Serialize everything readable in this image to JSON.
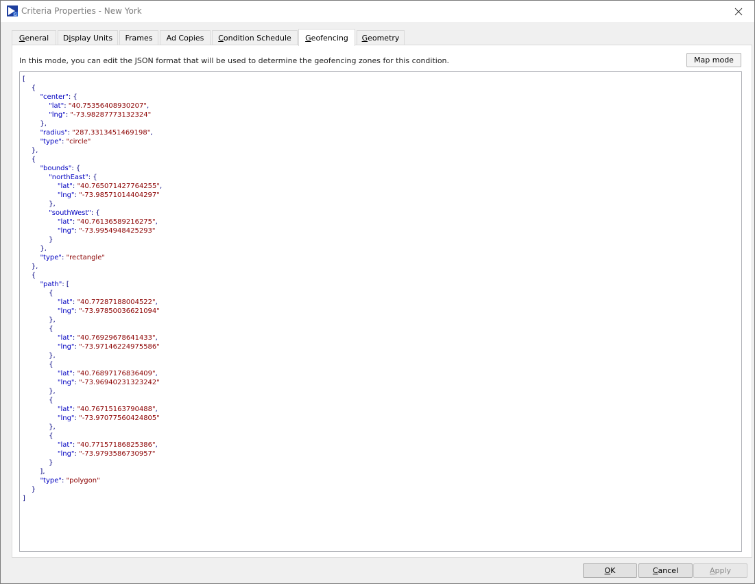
{
  "window": {
    "title": "Criteria Properties - New York"
  },
  "tabs": [
    {
      "label": "General",
      "mnemonic_index": 0
    },
    {
      "label": "Display Units",
      "mnemonic_index": 1
    },
    {
      "label": "Frames",
      "mnemonic_index": -1
    },
    {
      "label": "Ad Copies",
      "mnemonic_index": -1
    },
    {
      "label": "Condition Schedule",
      "mnemonic_index": 0
    },
    {
      "label": "Geofencing",
      "mnemonic_index": 0,
      "active": true
    },
    {
      "label": "Geometry",
      "mnemonic_index": 0
    }
  ],
  "geofencing": {
    "description": "In this mode, you can edit the JSON format that will be used to determine the geofencing zones for this condition.",
    "map_mode_label": "Map mode",
    "json_lines": [
      [
        [
          "p",
          "["
        ]
      ],
      [
        [
          "p",
          "    {"
        ]
      ],
      [
        [
          "p",
          "        "
        ],
        [
          "k",
          "\"center\""
        ],
        [
          "p",
          ": {"
        ]
      ],
      [
        [
          "p",
          "            "
        ],
        [
          "k",
          "\"lat\""
        ],
        [
          "p",
          ": "
        ],
        [
          "s",
          "\"40.75356408930207\""
        ],
        [
          "p",
          ","
        ]
      ],
      [
        [
          "p",
          "            "
        ],
        [
          "k",
          "\"lng\""
        ],
        [
          "p",
          ": "
        ],
        [
          "s",
          "\"-73.98287773132324\""
        ]
      ],
      [
        [
          "p",
          "        },"
        ]
      ],
      [
        [
          "p",
          "        "
        ],
        [
          "k",
          "\"radius\""
        ],
        [
          "p",
          ": "
        ],
        [
          "s",
          "\"287.3313451469198\""
        ],
        [
          "p",
          ","
        ]
      ],
      [
        [
          "p",
          "        "
        ],
        [
          "k",
          "\"type\""
        ],
        [
          "p",
          ": "
        ],
        [
          "s",
          "\"circle\""
        ]
      ],
      [
        [
          "p",
          "    },"
        ]
      ],
      [
        [
          "p",
          "    {"
        ]
      ],
      [
        [
          "p",
          "        "
        ],
        [
          "k",
          "\"bounds\""
        ],
        [
          "p",
          ": {"
        ]
      ],
      [
        [
          "p",
          "            "
        ],
        [
          "k",
          "\"northEast\""
        ],
        [
          "p",
          ": {"
        ]
      ],
      [
        [
          "p",
          "                "
        ],
        [
          "k",
          "\"lat\""
        ],
        [
          "p",
          ": "
        ],
        [
          "s",
          "\"40.765071427764255\""
        ],
        [
          "p",
          ","
        ]
      ],
      [
        [
          "p",
          "                "
        ],
        [
          "k",
          "\"lng\""
        ],
        [
          "p",
          ": "
        ],
        [
          "s",
          "\"-73.98571014404297\""
        ]
      ],
      [
        [
          "p",
          "            },"
        ]
      ],
      [
        [
          "p",
          "            "
        ],
        [
          "k",
          "\"southWest\""
        ],
        [
          "p",
          ": {"
        ]
      ],
      [
        [
          "p",
          "                "
        ],
        [
          "k",
          "\"lat\""
        ],
        [
          "p",
          ": "
        ],
        [
          "s",
          "\"40.76136589216275\""
        ],
        [
          "p",
          ","
        ]
      ],
      [
        [
          "p",
          "                "
        ],
        [
          "k",
          "\"lng\""
        ],
        [
          "p",
          ": "
        ],
        [
          "s",
          "\"-73.9954948425293\""
        ]
      ],
      [
        [
          "p",
          "            }"
        ]
      ],
      [
        [
          "p",
          "        },"
        ]
      ],
      [
        [
          "p",
          "        "
        ],
        [
          "k",
          "\"type\""
        ],
        [
          "p",
          ": "
        ],
        [
          "s",
          "\"rectangle\""
        ]
      ],
      [
        [
          "p",
          "    },"
        ]
      ],
      [
        [
          "p",
          "    {"
        ]
      ],
      [
        [
          "p",
          "        "
        ],
        [
          "k",
          "\"path\""
        ],
        [
          "p",
          ": ["
        ]
      ],
      [
        [
          "p",
          "            {"
        ]
      ],
      [
        [
          "p",
          "                "
        ],
        [
          "k",
          "\"lat\""
        ],
        [
          "p",
          ": "
        ],
        [
          "s",
          "\"40.77287188004522\""
        ],
        [
          "p",
          ","
        ]
      ],
      [
        [
          "p",
          "                "
        ],
        [
          "k",
          "\"lng\""
        ],
        [
          "p",
          ": "
        ],
        [
          "s",
          "\"-73.97850036621094\""
        ]
      ],
      [
        [
          "p",
          "            },"
        ]
      ],
      [
        [
          "p",
          "            {"
        ]
      ],
      [
        [
          "p",
          "                "
        ],
        [
          "k",
          "\"lat\""
        ],
        [
          "p",
          ": "
        ],
        [
          "s",
          "\"40.76929678641433\""
        ],
        [
          "p",
          ","
        ]
      ],
      [
        [
          "p",
          "                "
        ],
        [
          "k",
          "\"lng\""
        ],
        [
          "p",
          ": "
        ],
        [
          "s",
          "\"-73.97146224975586\""
        ]
      ],
      [
        [
          "p",
          "            },"
        ]
      ],
      [
        [
          "p",
          "            {"
        ]
      ],
      [
        [
          "p",
          "                "
        ],
        [
          "k",
          "\"lat\""
        ],
        [
          "p",
          ": "
        ],
        [
          "s",
          "\"40.76897176836409\""
        ],
        [
          "p",
          ","
        ]
      ],
      [
        [
          "p",
          "                "
        ],
        [
          "k",
          "\"lng\""
        ],
        [
          "p",
          ": "
        ],
        [
          "s",
          "\"-73.96940231323242\""
        ]
      ],
      [
        [
          "p",
          "            },"
        ]
      ],
      [
        [
          "p",
          "            {"
        ]
      ],
      [
        [
          "p",
          "                "
        ],
        [
          "k",
          "\"lat\""
        ],
        [
          "p",
          ": "
        ],
        [
          "s",
          "\"40.76715163790488\""
        ],
        [
          "p",
          ","
        ]
      ],
      [
        [
          "p",
          "                "
        ],
        [
          "k",
          "\"lng\""
        ],
        [
          "p",
          ": "
        ],
        [
          "s",
          "\"-73.97077560424805\""
        ]
      ],
      [
        [
          "p",
          "            },"
        ]
      ],
      [
        [
          "p",
          "            {"
        ]
      ],
      [
        [
          "p",
          "                "
        ],
        [
          "k",
          "\"lat\""
        ],
        [
          "p",
          ": "
        ],
        [
          "s",
          "\"40.77157186825386\""
        ],
        [
          "p",
          ","
        ]
      ],
      [
        [
          "p",
          "                "
        ],
        [
          "k",
          "\"lng\""
        ],
        [
          "p",
          ": "
        ],
        [
          "s",
          "\"-73.9793586730957\""
        ]
      ],
      [
        [
          "p",
          "            }"
        ]
      ],
      [
        [
          "p",
          "        ],"
        ]
      ],
      [
        [
          "p",
          "        "
        ],
        [
          "k",
          "\"type\""
        ],
        [
          "p",
          ": "
        ],
        [
          "s",
          "\"polygon\""
        ]
      ],
      [
        [
          "p",
          "    }"
        ]
      ],
      [
        [
          "p",
          "]"
        ]
      ]
    ]
  },
  "footer": {
    "ok_label": "OK",
    "cancel_label": "Cancel",
    "apply_label": "Apply",
    "apply_enabled": false
  },
  "icons": {
    "app": "app-logo-icon",
    "close": "close-icon"
  },
  "colors": {
    "json_key": "#0000c0",
    "json_string": "#8b0000",
    "json_punct": "#000080",
    "tab_border": "#d9d9d9",
    "button_face": "#e1e1e1"
  }
}
